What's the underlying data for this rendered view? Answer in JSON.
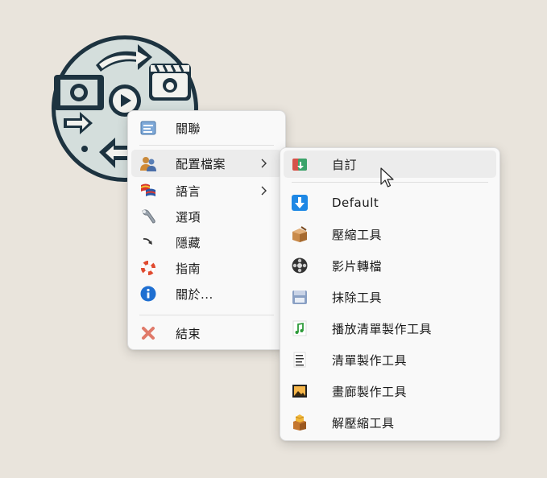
{
  "app_icon": {
    "name": "app-logo"
  },
  "main_menu": {
    "items": [
      {
        "label": "關聯",
        "icon": "association-icon",
        "submenu": false
      },
      {
        "label": "配置檔案",
        "icon": "profile-users-icon",
        "submenu": true
      },
      {
        "label": "語言",
        "icon": "language-flags-icon",
        "submenu": true
      },
      {
        "label": "選項",
        "icon": "wrench-icon",
        "submenu": false
      },
      {
        "label": "隱藏",
        "icon": "hide-arrow-icon",
        "submenu": false
      },
      {
        "label": "指南",
        "icon": "lifebuoy-icon",
        "submenu": false
      },
      {
        "label": "關於...",
        "icon": "info-icon",
        "submenu": false
      },
      {
        "label": "結束",
        "icon": "exit-x-icon",
        "submenu": false
      }
    ]
  },
  "profile_submenu": {
    "items": [
      {
        "label": "自訂",
        "icon": "custom-profile-icon"
      },
      {
        "label": "Default",
        "icon": "download-arrow-icon"
      },
      {
        "label": "壓縮工具",
        "icon": "compress-box-icon"
      },
      {
        "label": "影片轉檔",
        "icon": "film-reel-icon"
      },
      {
        "label": "抹除工具",
        "icon": "erase-disk-icon"
      },
      {
        "label": "播放清單製作工具",
        "icon": "music-note-icon"
      },
      {
        "label": "清單製作工具",
        "icon": "text-list-icon"
      },
      {
        "label": "畫廊製作工具",
        "icon": "picture-gallery-icon"
      },
      {
        "label": "解壓縮工具",
        "icon": "extract-box-icon"
      }
    ]
  },
  "colors": {
    "background": "#e9e4dc",
    "menu_background": "#f9f9f9",
    "hover": "#ececec",
    "logo_dark": "#1d3340",
    "logo_light": "#d4dedc"
  }
}
